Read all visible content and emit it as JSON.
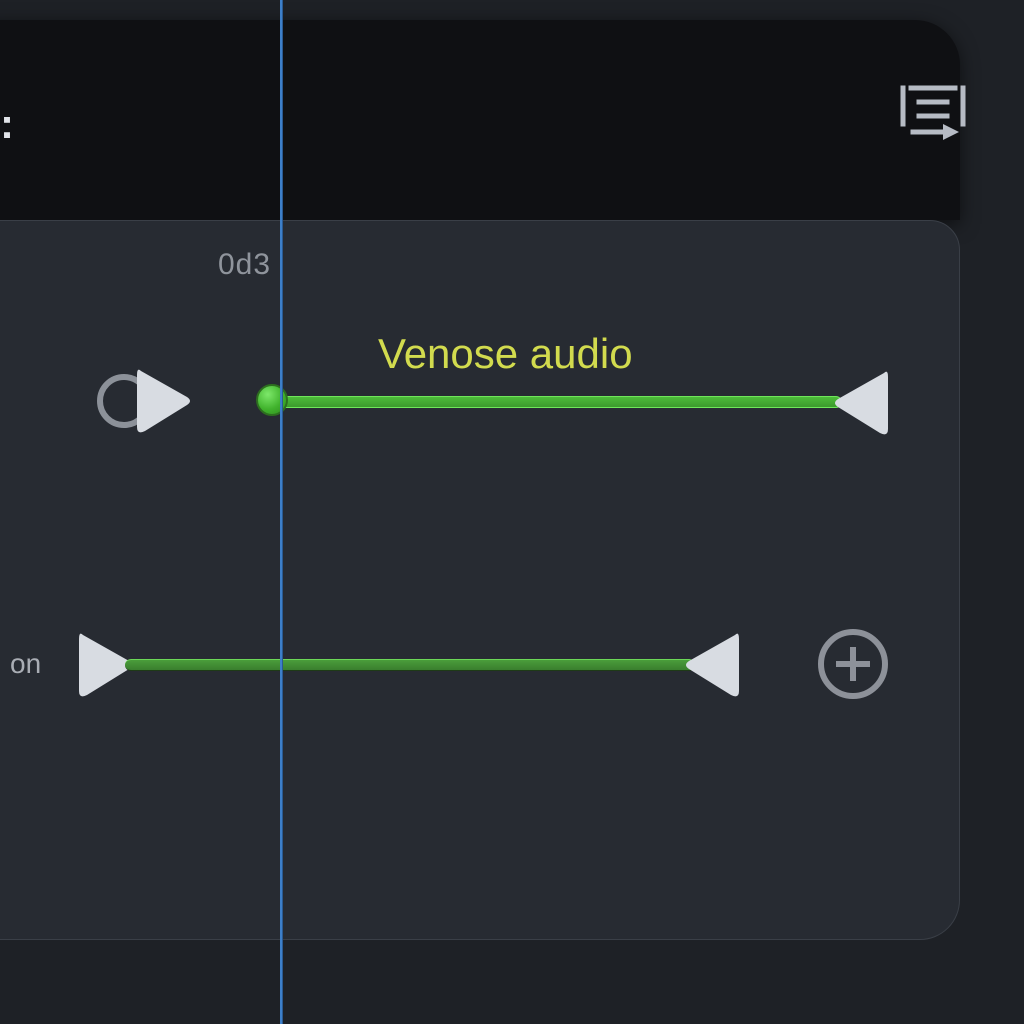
{
  "header": {
    "glyph": ":",
    "export_icon_name": "export-list-icon"
  },
  "timeline": {
    "timecode_label": "0d3",
    "playhead_color": "#3d7fc9"
  },
  "tracks": [
    {
      "id": 1,
      "label": "Venose audio",
      "label_color": "#d2db4e",
      "record_enabled": false,
      "has_record_ring": true,
      "bar_color": "#4dbb3a",
      "start_shape": "dot",
      "end_shape": "triangle",
      "side_label": ""
    },
    {
      "id": 2,
      "label": "",
      "bar_color": "#4a9d3b",
      "start_shape": "triangle",
      "end_shape": "triangle",
      "side_label": "on",
      "has_add_button": true
    }
  ],
  "icons": {
    "add": "plus-circle-icon",
    "play": "play-icon",
    "record": "record-ring-icon"
  }
}
